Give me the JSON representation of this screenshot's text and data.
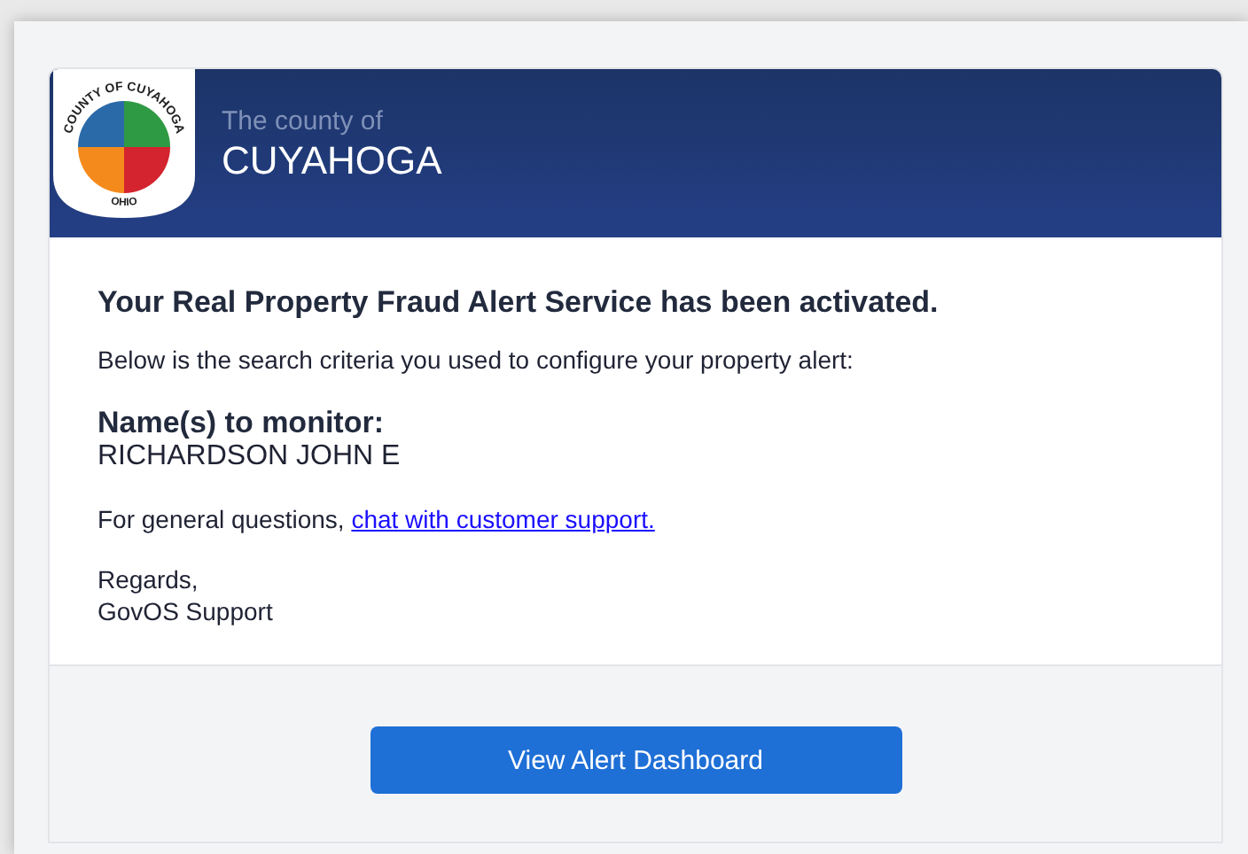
{
  "header": {
    "seal_top": "COUNTY OF CUYAHOGA",
    "seal_bottom": "OHIO",
    "subtitle": "The county of",
    "title": "CUYAHOGA"
  },
  "body": {
    "heading": "Your Real Property Fraud Alert Service has been activated.",
    "intro": "Below is the search criteria you used to configure your property alert:",
    "criteria_label": "Name(s) to monitor:",
    "criteria_value": "RICHARDSON JOHN E",
    "questions_text": "For general questions,",
    "support_link": "chat with customer support.",
    "regards": "Regards,",
    "signature": "GovOS Support"
  },
  "footer": {
    "button": "View Alert Dashboard"
  }
}
